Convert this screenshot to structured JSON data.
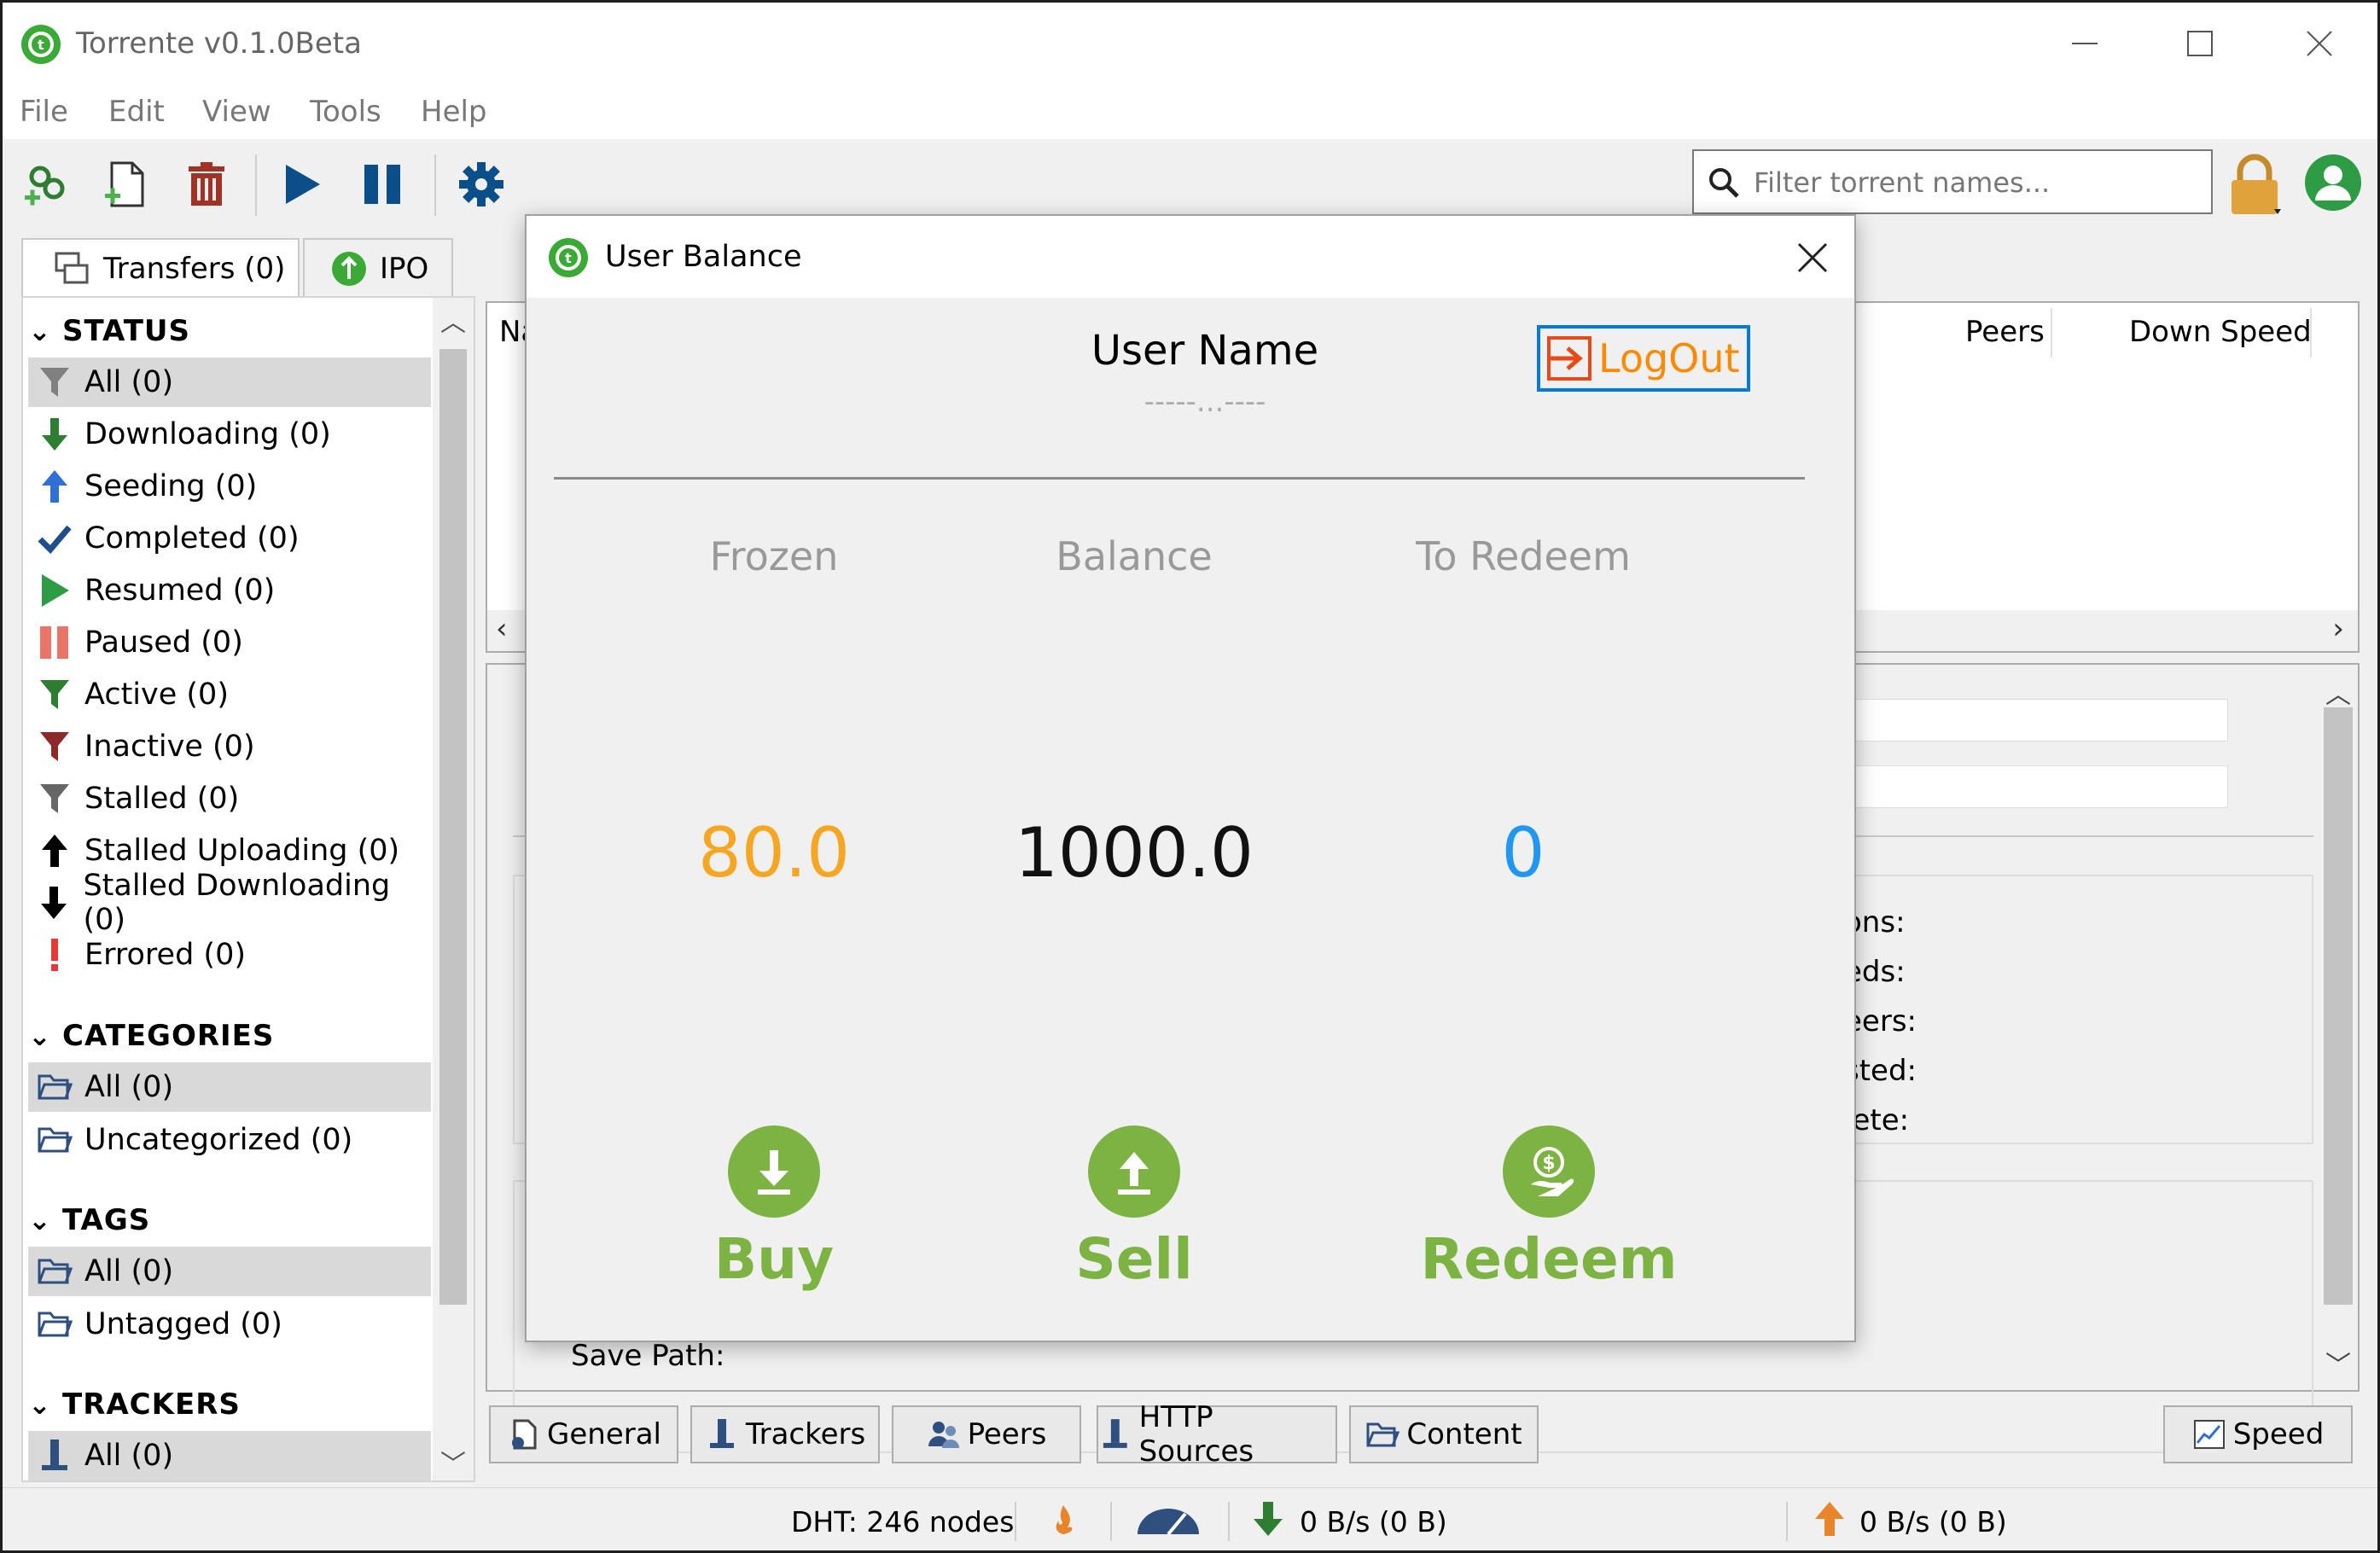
{
  "window": {
    "title": "Torrente v0.1.0Beta"
  },
  "menu": [
    "File",
    "Edit",
    "View",
    "Tools",
    "Help"
  ],
  "toolbar": {
    "buttons": [
      "add-link-icon",
      "add-torrent-file-icon",
      "delete-icon",
      "play-icon",
      "pause-icon",
      "settings-icon"
    ],
    "search_placeholder": "Filter torrent names..."
  },
  "left_tabs": [
    "Transfers (0)",
    "IPO"
  ],
  "sidebar": {
    "status_header": "STATUS",
    "status": [
      {
        "label": "All (0)",
        "icon": "filter-icon"
      },
      {
        "label": "Downloading (0)",
        "icon": "down-arrow-icon"
      },
      {
        "label": "Seeding (0)",
        "icon": "up-arrow-icon"
      },
      {
        "label": "Completed (0)",
        "icon": "checkmark-icon"
      },
      {
        "label": "Resumed (0)",
        "icon": "play-icon"
      },
      {
        "label": "Paused (0)",
        "icon": "pause-icon"
      },
      {
        "label": "Active (0)",
        "icon": "filter-icon"
      },
      {
        "label": "Inactive (0)",
        "icon": "filter-icon"
      },
      {
        "label": "Stalled (0)",
        "icon": "filter-icon"
      },
      {
        "label": "Stalled Uploading (0)",
        "icon": "up-arrow-icon"
      },
      {
        "label": "Stalled Downloading (0)",
        "icon": "down-arrow-icon"
      },
      {
        "label": "Errored (0)",
        "icon": "exclamation-icon"
      }
    ],
    "categories_header": "CATEGORIES",
    "categories": [
      "All (0)",
      "Uncategorized (0)"
    ],
    "tags_header": "TAGS",
    "tags": [
      "All (0)",
      "Untagged (0)"
    ],
    "trackers_header": "TRACKERS",
    "trackers": [
      "All (0)"
    ]
  },
  "list": {
    "columns": [
      "Na",
      "Peers",
      "Down Speed"
    ]
  },
  "details": {
    "labels": [
      "ons:",
      "eds:",
      "eers:",
      "sted:",
      "lete:",
      ":",
      ":"
    ],
    "save_path_label": "Save Path:"
  },
  "bottom_tabs": [
    "General",
    "Trackers",
    "Peers",
    "HTTP Sources",
    "Content",
    "Speed"
  ],
  "statusbar": {
    "dht": "DHT: 246 nodes",
    "download": "0 B/s (0 B)",
    "upload": "0 B/s (0 B)"
  },
  "dialog": {
    "title": "User Balance",
    "user_name": "User Name",
    "user_id": "-----...----",
    "logout_label": "LogOut",
    "stats": [
      {
        "label": "Frozen",
        "value": "80.0",
        "color": "#f5a623"
      },
      {
        "label": "Balance",
        "value": "1000.0",
        "color": "#111111"
      },
      {
        "label": "To Redeem",
        "value": "0",
        "color": "#2196f3"
      }
    ],
    "actions": [
      {
        "label": "Buy",
        "icon": "download-icon"
      },
      {
        "label": "Sell",
        "icon": "upload-icon"
      },
      {
        "label": "Redeem",
        "icon": "dollar-hand-icon"
      }
    ],
    "accent_green": "#7cb342",
    "logout_color": "#ff8a00"
  }
}
